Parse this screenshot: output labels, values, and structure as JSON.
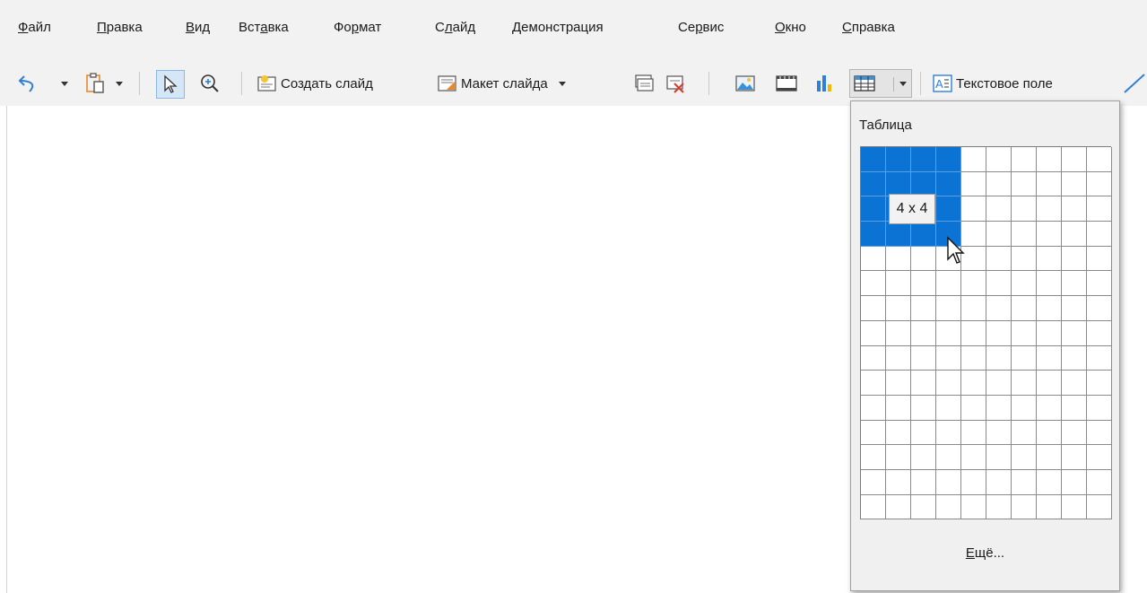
{
  "menu": {
    "items": [
      {
        "underline": "Ф",
        "rest": "айл"
      },
      {
        "underline": "П",
        "rest": "равка"
      },
      {
        "underline": "В",
        "rest": "ид"
      },
      {
        "pre": "Вст",
        "underline": "а",
        "rest": "вка"
      },
      {
        "pre": "Фо",
        "underline": "р",
        "rest": "мат"
      },
      {
        "pre": "С",
        "underline": "л",
        "rest": "айд"
      },
      {
        "underline": "Д",
        "rest": "емонстрация"
      },
      {
        "pre": "Се",
        "underline": "р",
        "rest": "вис"
      },
      {
        "underline": "О",
        "rest": "кно"
      },
      {
        "underline": "С",
        "rest": "правка"
      }
    ]
  },
  "toolbar": {
    "new_slide_label": "Создать слайд",
    "slide_layout_label": "Макет слайда",
    "text_box_label": "Текстовое поле"
  },
  "icons": [
    "undo-icon",
    "paste-icon",
    "select-icon",
    "zoom-icon",
    "new-slide-icon",
    "slide-layout-icon",
    "duplicate-slide-icon",
    "delete-slide-icon",
    "image-icon",
    "media-icon",
    "chart-icon",
    "table-icon",
    "text-box-icon",
    "line-icon"
  ],
  "table_popup": {
    "title": "Таблица",
    "columns": 10,
    "rows": 15,
    "selected_columns": 4,
    "selected_rows": 4,
    "size_label": "4 x 4",
    "more_label": "Ещё...",
    "more_underline": "Е",
    "more_rest": "щё..."
  },
  "colors": {
    "selection": "#0a73d4",
    "chrome": "#f2f2f2",
    "accent_orange": "#e8892d"
  }
}
